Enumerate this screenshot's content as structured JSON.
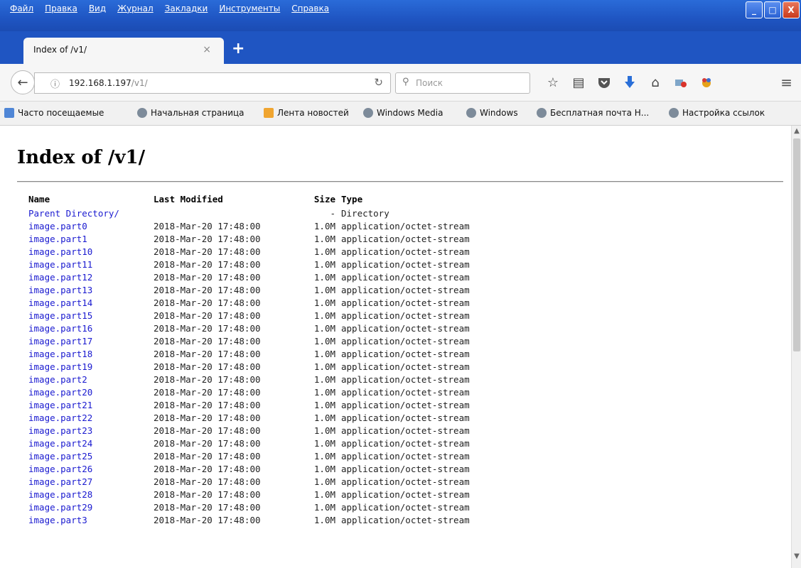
{
  "menu": [
    "Файл",
    "Правка",
    "Вид",
    "Журнал",
    "Закладки",
    "Инструменты",
    "Справка"
  ],
  "window_buttons": {
    "minimize": "_",
    "maximize": "□",
    "close": "X"
  },
  "tab": {
    "title": "Index of /v1/",
    "close": "×",
    "new_tab": "+"
  },
  "nav": {
    "back": "←",
    "info": "ⓘ",
    "url_host": "192.168.1.197",
    "url_path": "/v1/",
    "reload": "↻",
    "search_placeholder": "Поиск",
    "search_icon": "⚲",
    "toolbar_icons": [
      "star-icon",
      "reader-icon",
      "pocket-icon",
      "download-icon",
      "home-icon",
      "addon-icon",
      "paint-icon"
    ],
    "menu_icon": "≡"
  },
  "bookmarks": [
    "Часто посещаемые",
    "Начальная страница",
    "Лента новостей",
    "Windows Media",
    "Windows",
    "Бесплатная почта Н...",
    "Настройка ссылок"
  ],
  "page": {
    "title": "Index of /v1/",
    "headers": {
      "name": "Name",
      "modified": "Last Modified",
      "size": "Size",
      "type": "Type"
    },
    "parent": {
      "name": "Parent Directory/",
      "modified": "",
      "size": "-",
      "type": "Directory"
    },
    "files": [
      {
        "name": "image.part0",
        "modified": "2018-Mar-20 17:48:00",
        "size": "1.0M",
        "type": "application/octet-stream"
      },
      {
        "name": "image.part1",
        "modified": "2018-Mar-20 17:48:00",
        "size": "1.0M",
        "type": "application/octet-stream"
      },
      {
        "name": "image.part10",
        "modified": "2018-Mar-20 17:48:00",
        "size": "1.0M",
        "type": "application/octet-stream"
      },
      {
        "name": "image.part11",
        "modified": "2018-Mar-20 17:48:00",
        "size": "1.0M",
        "type": "application/octet-stream"
      },
      {
        "name": "image.part12",
        "modified": "2018-Mar-20 17:48:00",
        "size": "1.0M",
        "type": "application/octet-stream"
      },
      {
        "name": "image.part13",
        "modified": "2018-Mar-20 17:48:00",
        "size": "1.0M",
        "type": "application/octet-stream"
      },
      {
        "name": "image.part14",
        "modified": "2018-Mar-20 17:48:00",
        "size": "1.0M",
        "type": "application/octet-stream"
      },
      {
        "name": "image.part15",
        "modified": "2018-Mar-20 17:48:00",
        "size": "1.0M",
        "type": "application/octet-stream"
      },
      {
        "name": "image.part16",
        "modified": "2018-Mar-20 17:48:00",
        "size": "1.0M",
        "type": "application/octet-stream"
      },
      {
        "name": "image.part17",
        "modified": "2018-Mar-20 17:48:00",
        "size": "1.0M",
        "type": "application/octet-stream"
      },
      {
        "name": "image.part18",
        "modified": "2018-Mar-20 17:48:00",
        "size": "1.0M",
        "type": "application/octet-stream"
      },
      {
        "name": "image.part19",
        "modified": "2018-Mar-20 17:48:00",
        "size": "1.0M",
        "type": "application/octet-stream"
      },
      {
        "name": "image.part2",
        "modified": "2018-Mar-20 17:48:00",
        "size": "1.0M",
        "type": "application/octet-stream"
      },
      {
        "name": "image.part20",
        "modified": "2018-Mar-20 17:48:00",
        "size": "1.0M",
        "type": "application/octet-stream"
      },
      {
        "name": "image.part21",
        "modified": "2018-Mar-20 17:48:00",
        "size": "1.0M",
        "type": "application/octet-stream"
      },
      {
        "name": "image.part22",
        "modified": "2018-Mar-20 17:48:00",
        "size": "1.0M",
        "type": "application/octet-stream"
      },
      {
        "name": "image.part23",
        "modified": "2018-Mar-20 17:48:00",
        "size": "1.0M",
        "type": "application/octet-stream"
      },
      {
        "name": "image.part24",
        "modified": "2018-Mar-20 17:48:00",
        "size": "1.0M",
        "type": "application/octet-stream"
      },
      {
        "name": "image.part25",
        "modified": "2018-Mar-20 17:48:00",
        "size": "1.0M",
        "type": "application/octet-stream"
      },
      {
        "name": "image.part26",
        "modified": "2018-Mar-20 17:48:00",
        "size": "1.0M",
        "type": "application/octet-stream"
      },
      {
        "name": "image.part27",
        "modified": "2018-Mar-20 17:48:00",
        "size": "1.0M",
        "type": "application/octet-stream"
      },
      {
        "name": "image.part28",
        "modified": "2018-Mar-20 17:48:00",
        "size": "1.0M",
        "type": "application/octet-stream"
      },
      {
        "name": "image.part29",
        "modified": "2018-Mar-20 17:48:00",
        "size": "1.0M",
        "type": "application/octet-stream"
      },
      {
        "name": "image.part3",
        "modified": "2018-Mar-20 17:48:00",
        "size": "1.0M",
        "type": "application/octet-stream"
      }
    ]
  },
  "colors": {
    "titlebar": "#1f55c2",
    "link": "#1a1ad0"
  }
}
